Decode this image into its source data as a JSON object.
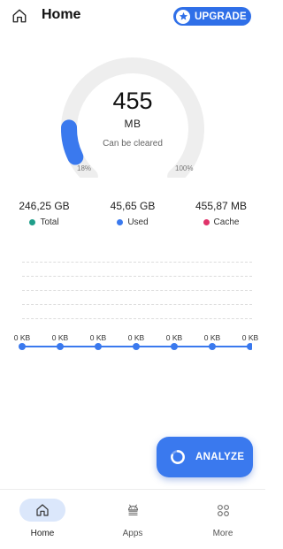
{
  "header": {
    "title": "Home",
    "upgrade_label": "UPGRADE"
  },
  "gauge": {
    "value": "455",
    "unit": "MB",
    "caption": "Can be cleared",
    "min_label": "18%",
    "max_label": "100%",
    "fill_fraction": 0.18,
    "track_color": "#eeeeee",
    "fill_color": "#3a79ee"
  },
  "stats": [
    {
      "value": "246,25 GB",
      "label": "Total",
      "color": "#1f9e8a"
    },
    {
      "value": "45,65 GB",
      "label": "Used",
      "color": "#3a79ee"
    },
    {
      "value": "455,87 MB",
      "label": "Cache",
      "color": "#e0336a"
    }
  ],
  "chart": {
    "point_labels": [
      "0 KB",
      "0 KB",
      "0 KB",
      "0 KB",
      "0 KB",
      "0 KB",
      "0 KB"
    ],
    "values": [
      0,
      0,
      0,
      0,
      0,
      0,
      0
    ],
    "line_color": "#3a79ee"
  },
  "analyze_label": "ANALYZE",
  "nav": [
    {
      "label": "Home",
      "icon": "home-icon",
      "active": true
    },
    {
      "label": "Apps",
      "icon": "android-icon",
      "active": false
    },
    {
      "label": "More",
      "icon": "grid-icon",
      "active": false
    }
  ]
}
